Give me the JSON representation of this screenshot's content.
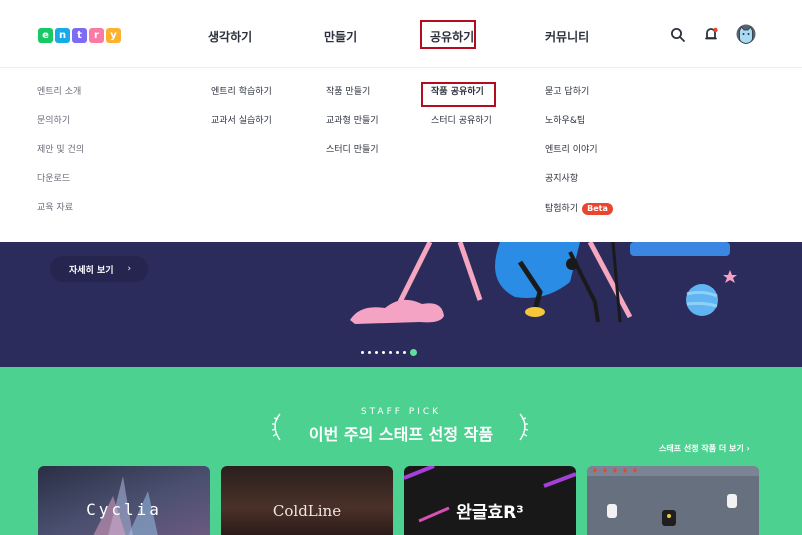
{
  "header": {
    "logo_letters": [
      "e",
      "n",
      "t",
      "r",
      "y"
    ],
    "nav": [
      "생각하기",
      "만들기",
      "공유하기",
      "커뮤니티"
    ],
    "icons": [
      "search-icon",
      "notification-bell-icon",
      "profile-avatar-icon"
    ]
  },
  "dropdown": {
    "col1": [
      "엔트리 소개",
      "문의하기",
      "제안 및 건의",
      "다운로드",
      "교육 자료"
    ],
    "col2": [
      "엔트리 학습하기",
      "교과서 실습하기"
    ],
    "col3": [
      "작품 만들기",
      "교과형 만들기",
      "스터디 만들기"
    ],
    "col4": [
      "작품 공유하기",
      "스터디 공유하기"
    ],
    "col5": [
      "묻고 답하기",
      "노하우&팁",
      "엔트리 이야기",
      "공지사항",
      "탐험하기"
    ],
    "beta_badge": "Beta"
  },
  "banner": {
    "detail_button": "자세히 보기",
    "detail_arrow": "›",
    "slide_count": 8,
    "active_slide": 8
  },
  "staff_pick": {
    "eyebrow": "STAFF PICK",
    "title": "이번 주의 스태프 선정 작품",
    "more_link": "스태프 선정 작품 더 보기 ›",
    "cards": [
      {
        "title": "Cyclia"
      },
      {
        "title": "ColdLine"
      },
      {
        "title": "완글효R³"
      },
      {
        "title": ""
      }
    ]
  },
  "colors": {
    "highlight_box": "#b20c20",
    "banner_bg": "#2c2c5c",
    "staff_bg": "#4dd191",
    "beta": "#e9452f"
  }
}
